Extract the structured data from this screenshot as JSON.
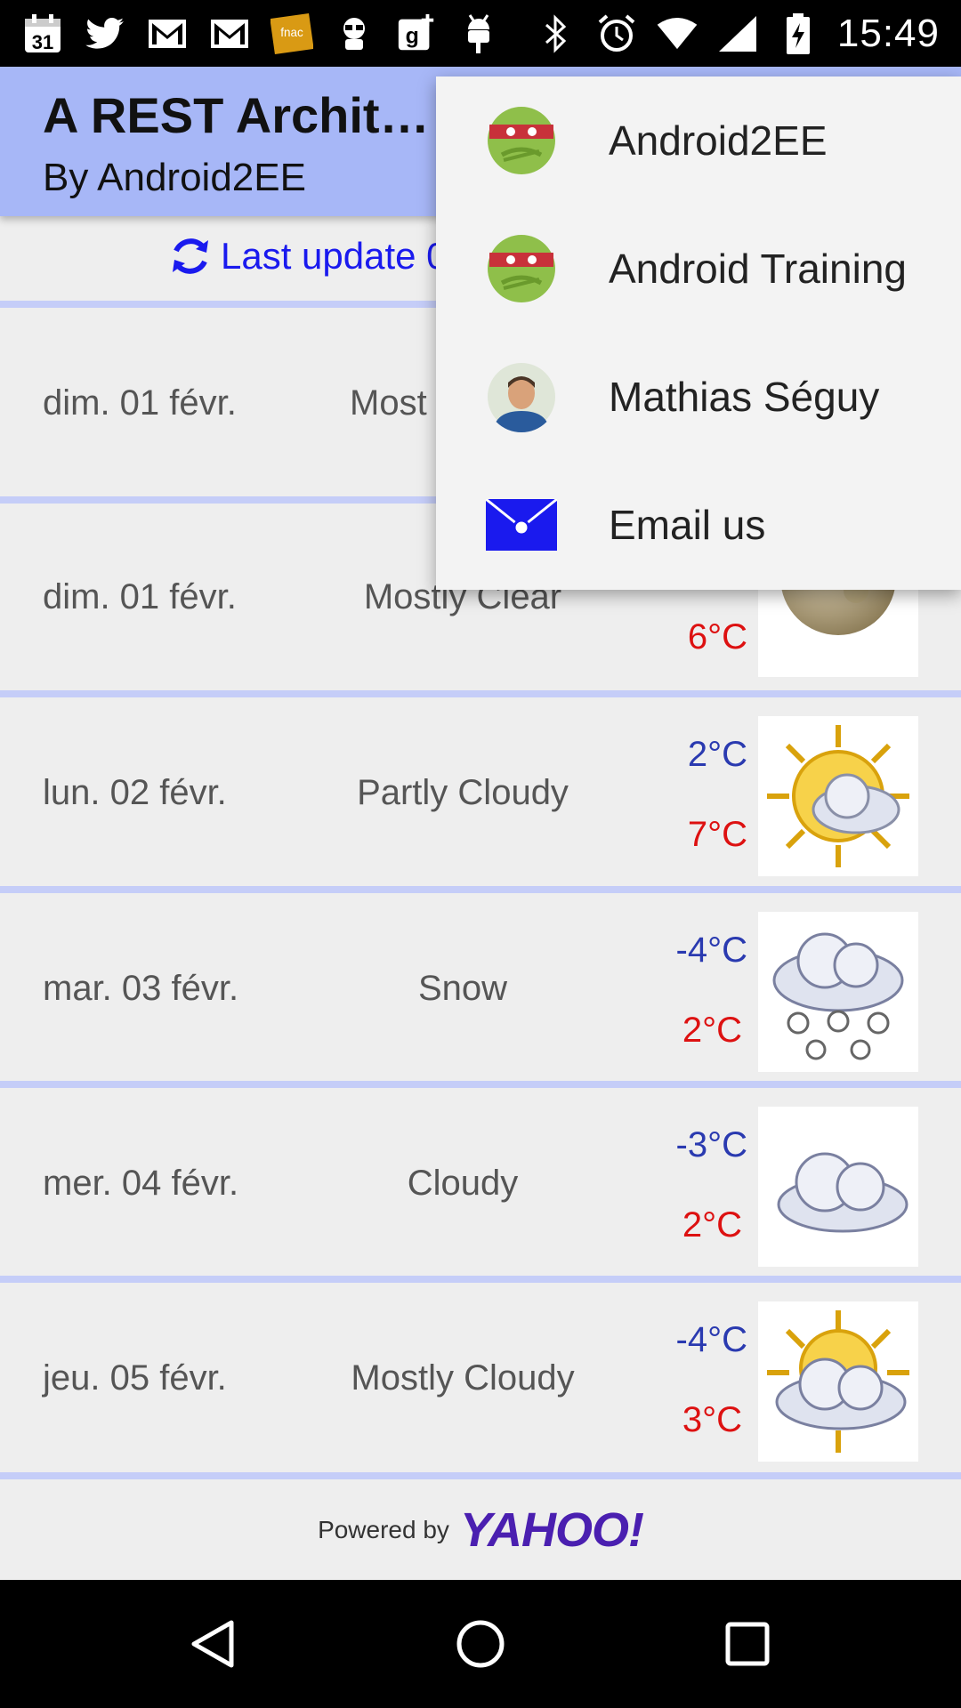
{
  "status_bar": {
    "time": "15:49",
    "calendar_day": "31",
    "notification_icons": [
      "calendar-icon",
      "twitter-icon",
      "gmail-icon",
      "gmail-icon",
      "fnac-icon",
      "android-hacker-icon",
      "google-plus-icon",
      "android-icon"
    ],
    "fnac_label": "fnac",
    "system_icons": [
      "bluetooth-icon",
      "alarm-icon",
      "wifi-icon",
      "signal-icon",
      "battery-charging-icon"
    ]
  },
  "app_bar": {
    "title": "A REST Archit…",
    "subtitle": "By Android2EE",
    "color": "#a7b7f7"
  },
  "last_update": {
    "text": "Last update 0",
    "color": "#1a1aee"
  },
  "forecast": [
    {
      "date": "dim. 01 févr.",
      "condition": "Most",
      "low": "",
      "high": "",
      "icon": "weather-icon"
    },
    {
      "date": "dim. 01 févr.",
      "condition": "Mostly Clear",
      "low": "",
      "high": "6°C",
      "icon": "moon-icon"
    },
    {
      "date": "lun. 02 févr.",
      "condition": "Partly Cloudy",
      "low": "2°C",
      "high": "7°C",
      "icon": "partly-cloudy-icon"
    },
    {
      "date": "mar. 03 févr.",
      "condition": "Snow",
      "low": "-4°C",
      "high": "2°C",
      "icon": "snow-icon"
    },
    {
      "date": "mer. 04 févr.",
      "condition": "Cloudy",
      "low": "-3°C",
      "high": "2°C",
      "icon": "cloudy-icon"
    },
    {
      "date": "jeu. 05 févr.",
      "condition": "Mostly Cloudy",
      "low": "-4°C",
      "high": "3°C",
      "icon": "mostly-cloudy-icon"
    }
  ],
  "footer": {
    "powered_by": "Powered by",
    "brand": "YAHOO!"
  },
  "menu": {
    "items": [
      {
        "label": "Android2EE",
        "icon": "android2ee-logo-icon"
      },
      {
        "label": "Android Training",
        "icon": "android2ee-logo-icon"
      },
      {
        "label": "Mathias Séguy",
        "icon": "profile-photo-icon"
      },
      {
        "label": "Email us",
        "icon": "email-icon"
      }
    ]
  },
  "navigation": {
    "buttons": [
      "back-icon",
      "home-icon",
      "recents-icon"
    ]
  },
  "colors": {
    "temp_low": "#2a3ab0",
    "temp_high": "#dd1111",
    "divider": "#c5cdf8",
    "background": "#eeeeee"
  }
}
